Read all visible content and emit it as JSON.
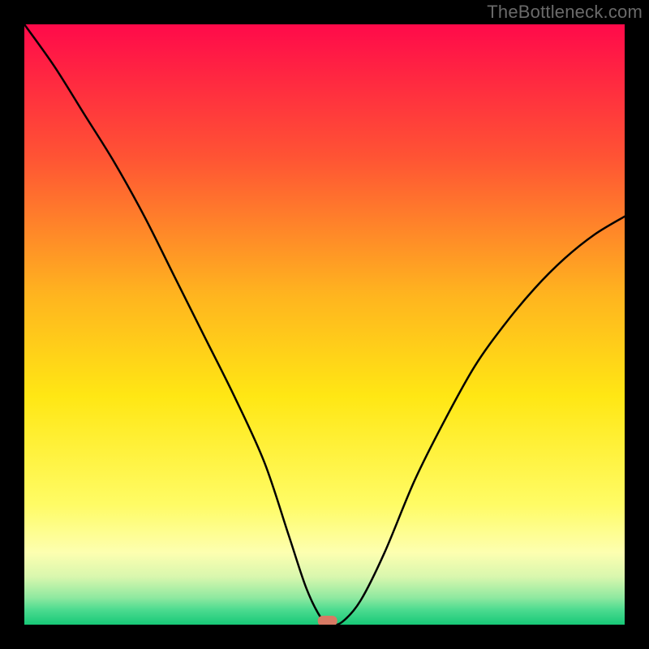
{
  "watermark": "TheBottleneck.com",
  "chart_data": {
    "type": "line",
    "title": "",
    "xlabel": "",
    "ylabel": "",
    "xlim": [
      0,
      100
    ],
    "ylim": [
      0,
      100
    ],
    "grid": false,
    "series": [
      {
        "name": "bottleneck-curve",
        "x": [
          0,
          5,
          10,
          15,
          20,
          25,
          30,
          35,
          40,
          44,
          47,
          49.5,
          51,
          53,
          56,
          60,
          65,
          70,
          75,
          80,
          85,
          90,
          95,
          100
        ],
        "y": [
          100,
          93,
          85,
          77,
          68,
          58,
          48,
          38,
          27,
          15,
          6,
          1,
          0,
          0.5,
          4,
          12,
          24,
          34,
          43,
          50,
          56,
          61,
          65,
          68
        ]
      }
    ],
    "annotations": [
      {
        "name": "optimal-marker",
        "x": 50.5,
        "y": 0,
        "color": "#d87a64"
      }
    ],
    "gradient_stops": [
      {
        "offset": 0.0,
        "color": "#ff0a4a"
      },
      {
        "offset": 0.22,
        "color": "#ff5334"
      },
      {
        "offset": 0.45,
        "color": "#ffb41f"
      },
      {
        "offset": 0.62,
        "color": "#ffe714"
      },
      {
        "offset": 0.8,
        "color": "#fffc65"
      },
      {
        "offset": 0.88,
        "color": "#fdffb0"
      },
      {
        "offset": 0.92,
        "color": "#d9f7ae"
      },
      {
        "offset": 0.955,
        "color": "#8fe9a0"
      },
      {
        "offset": 0.975,
        "color": "#4ddb90"
      },
      {
        "offset": 1.0,
        "color": "#17c977"
      }
    ]
  }
}
